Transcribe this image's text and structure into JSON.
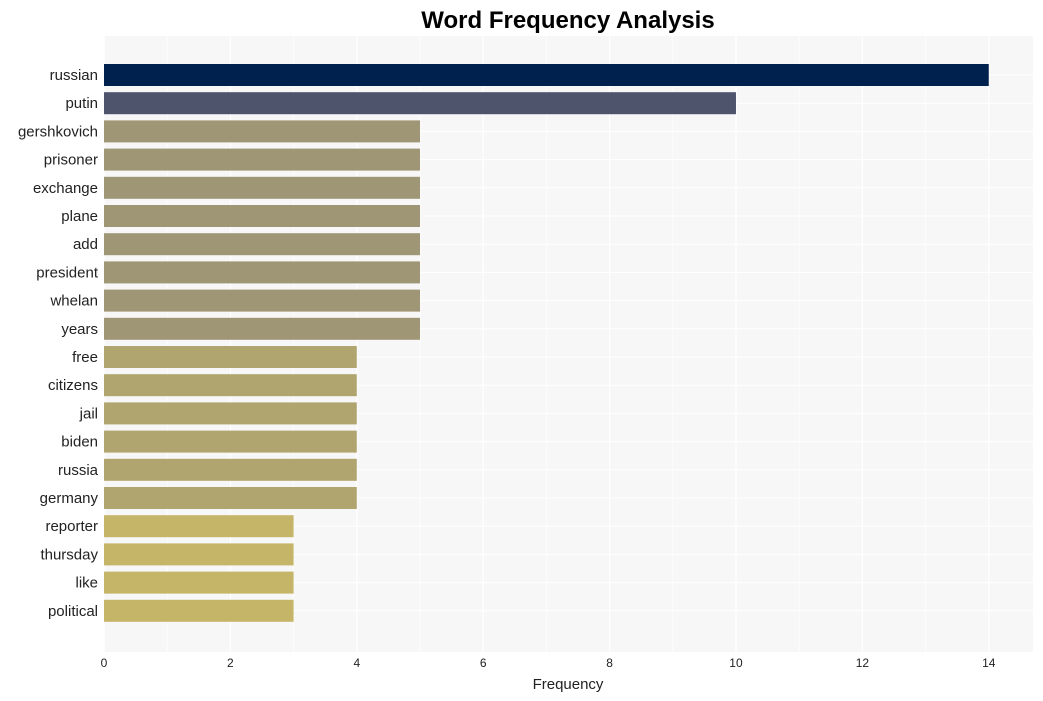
{
  "chart_data": {
    "type": "bar",
    "orientation": "horizontal",
    "title": "Word Frequency Analysis",
    "xlabel": "Frequency",
    "ylabel": "",
    "xlim": [
      0,
      14.7
    ],
    "xticks": [
      0,
      2,
      4,
      6,
      8,
      10,
      12,
      14
    ],
    "grid": true,
    "categories": [
      "russian",
      "putin",
      "gershkovich",
      "prisoner",
      "exchange",
      "plane",
      "add",
      "president",
      "whelan",
      "years",
      "free",
      "citizens",
      "jail",
      "biden",
      "russia",
      "germany",
      "reporter",
      "thursday",
      "like",
      "political"
    ],
    "values": [
      14,
      10,
      5,
      5,
      5,
      5,
      5,
      5,
      5,
      5,
      4,
      4,
      4,
      4,
      4,
      4,
      3,
      3,
      3,
      3
    ],
    "colors": [
      "#00214d",
      "#4d546c",
      "#9f9676",
      "#9f9676",
      "#9f9676",
      "#9f9676",
      "#9f9676",
      "#9f9676",
      "#9f9676",
      "#9f9676",
      "#b1a56f",
      "#b1a56f",
      "#b1a56f",
      "#b1a56f",
      "#b1a56f",
      "#b1a56f",
      "#c5b568",
      "#c5b568",
      "#c5b568",
      "#c5b568"
    ]
  }
}
